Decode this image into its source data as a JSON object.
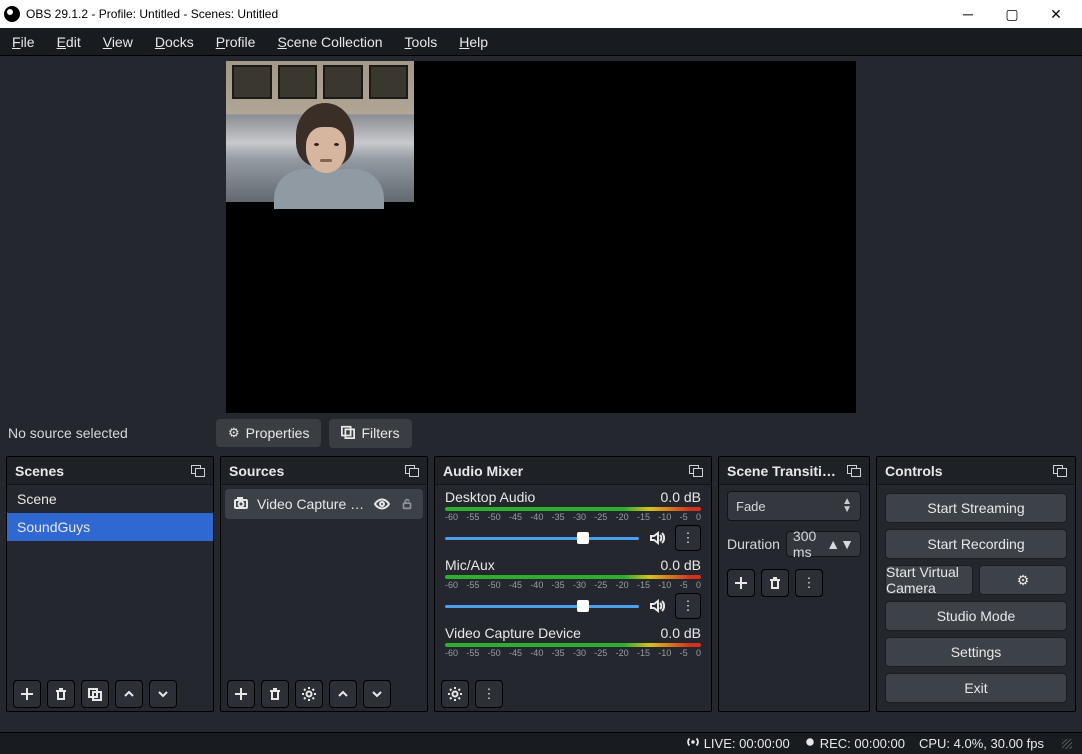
{
  "window": {
    "title": "OBS 29.1.2 - Profile: Untitled - Scenes: Untitled"
  },
  "menu": {
    "file": "File",
    "edit": "Edit",
    "view": "View",
    "docks": "Docks",
    "profile": "Profile",
    "scenecol": "Scene Collection",
    "tools": "Tools",
    "help": "Help"
  },
  "toolbar": {
    "no_source": "No source selected",
    "properties": "Properties",
    "filters": "Filters"
  },
  "panels": {
    "scenes": "Scenes",
    "sources": "Sources",
    "mixer": "Audio Mixer",
    "transitions": "Scene Transiti…",
    "controls": "Controls"
  },
  "scenes": {
    "items": [
      "Scene",
      "SoundGuys"
    ],
    "selected_index": 1
  },
  "sources": {
    "items": [
      {
        "name": "Video Capture Dev",
        "visible": true,
        "locked": false
      }
    ]
  },
  "mixer": {
    "ticks": [
      "-60",
      "-55",
      "-50",
      "-45",
      "-40",
      "-35",
      "-30",
      "-25",
      "-20",
      "-15",
      "-10",
      "-5",
      "0"
    ],
    "channels": [
      {
        "name": "Desktop Audio",
        "db": "0.0 dB",
        "thumb_pct": 68,
        "has_controls": true
      },
      {
        "name": "Mic/Aux",
        "db": "0.0 dB",
        "thumb_pct": 68,
        "has_controls": true
      },
      {
        "name": "Video Capture Device",
        "db": "0.0 dB",
        "thumb_pct": 68,
        "has_controls": false
      }
    ]
  },
  "transitions": {
    "selected": "Fade",
    "duration_label": "Duration",
    "duration_value": "300 ms"
  },
  "controls": {
    "start_streaming": "Start Streaming",
    "start_recording": "Start Recording",
    "virtual_camera": "Start Virtual Camera",
    "studio_mode": "Studio Mode",
    "settings": "Settings",
    "exit": "Exit"
  },
  "status": {
    "live": "LIVE: 00:00:00",
    "rec": "REC: 00:00:00",
    "cpu": "CPU: 4.0%, 30.00 fps"
  }
}
